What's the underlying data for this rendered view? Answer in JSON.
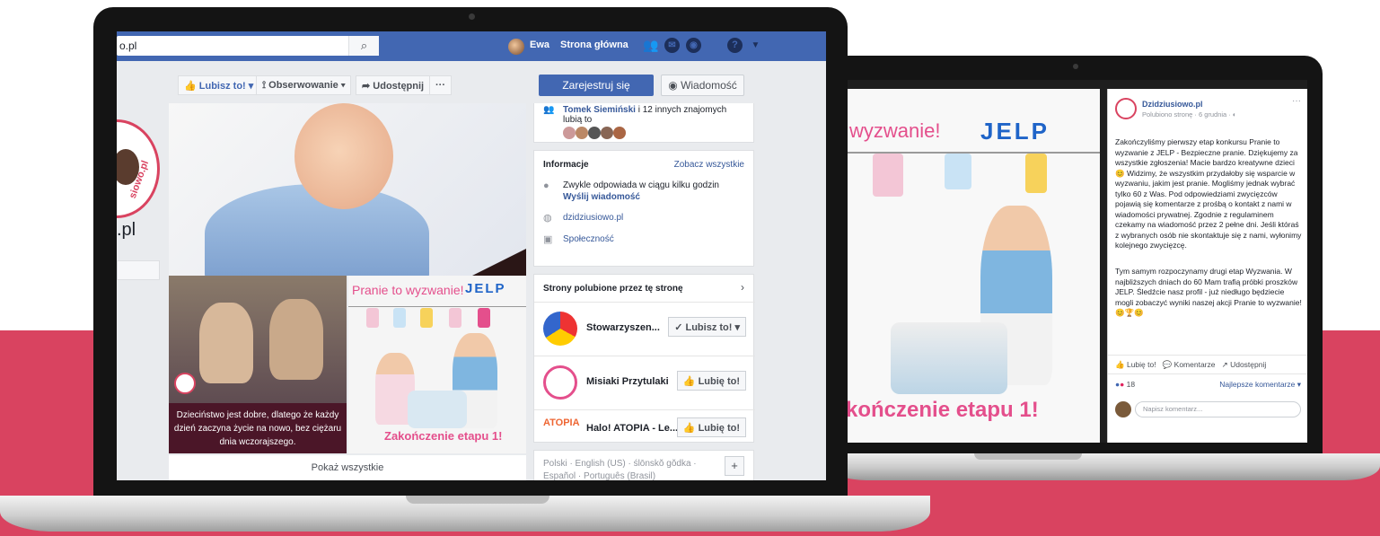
{
  "fb_page": {
    "search_value": "o.pl",
    "user_name": "Ewa",
    "home_label": "Strona główna",
    "page_name_partial": ".pl",
    "logo_word": "siowo.pl",
    "actions": {
      "like": "Lubisz to!",
      "follow": "Obserwowanie",
      "share": "Udostępnij",
      "more": "···",
      "register": "Zarejestruj się",
      "message": "Wiadomość"
    },
    "friends_like": {
      "name": "Tomek Siemiński",
      "rest": " i 12 innych znajomych lubią to"
    },
    "info": {
      "title": "Informacje",
      "see_all": "Zobacz wszystkie",
      "response": "Zwykle odpowiada w ciągu kilku godzin",
      "send_message": "Wyślij wiadomość",
      "website": "dzidziusiowo.pl",
      "category": "Społeczność"
    },
    "liked_pages": {
      "title": "Strony polubione przez tę stronę",
      "items": [
        {
          "name": "Stowarzyszen...",
          "button": "Lubisz to!"
        },
        {
          "name": "Misiaki Przytulaki",
          "button": "Lubię to!"
        },
        {
          "name": "Halo! ATOPIA - Le...",
          "button": "Lubię to!"
        }
      ]
    },
    "languages": "Polski · English (US) · ślōnskŏ gŏdka · Español · Português (Brasil)",
    "show_all": "Pokaż wszystkie",
    "tile1_caption": "Dzieciństwo jest dobre, dlatego że każdy dzień zaczyna życie na nowo, bez ciężaru dnia wczorajszego.",
    "tile2": {
      "title": "Pranie to wyzwanie!",
      "brand": "JELP",
      "footer": "Zakończenie etapu 1!"
    }
  },
  "post": {
    "image_title": "wyzwanie!",
    "image_brand": "JELP",
    "image_footer": "kończenie etapu 1!",
    "author": "Dzidziusiowo.pl",
    "meta": "Polubiono stronę · 6 grudnia · ◐",
    "text": "Zakończyliśmy pierwszy etap konkursu Pranie to wyzwanie z JELP - Bezpieczne pranie. Dziękujemy za wszystkie zgłoszenia! Macie bardzo kreatywne dzieci 😊 Widzimy, że wszystkim przydałoby się wsparcie w wyzwaniu, jakim jest pranie. Mogliśmy jednak wybrać tylko 60 z Was. Pod odpowiedziami zwycięzców pojawią się komentarze z prośbą o kontakt z nami w wiadomości prywatnej. Zgodnie z regulaminem czekamy na wiadomość przez 2 pełne dni. Jeśli któraś z wybranych osób nie skontaktuje się z nami, wyłonimy kolejnego zwycięzcę.",
    "text2": "Tym samym rozpoczynamy drugi etap Wyzwania. W najbliższych dniach do 60 Mam trafią próbki proszków JELP. Śledźcie nasz profil - już niedługo będziecie mogli zobaczyć wyniki naszej akcji Pranie to wyzwanie! 😊🏆😊",
    "like": "Lubię to!",
    "comment": "Komentarze",
    "share": "Udostępnij",
    "reactions": "18",
    "top_comments": "Najlepsze komentarze ▾",
    "comment_placeholder": "Napisz komentarz..."
  },
  "colors": {
    "accent": "#d94360",
    "fb_blue": "#4267b2",
    "jelp_blue": "#1f64c8",
    "pink": "#e44f8c"
  }
}
